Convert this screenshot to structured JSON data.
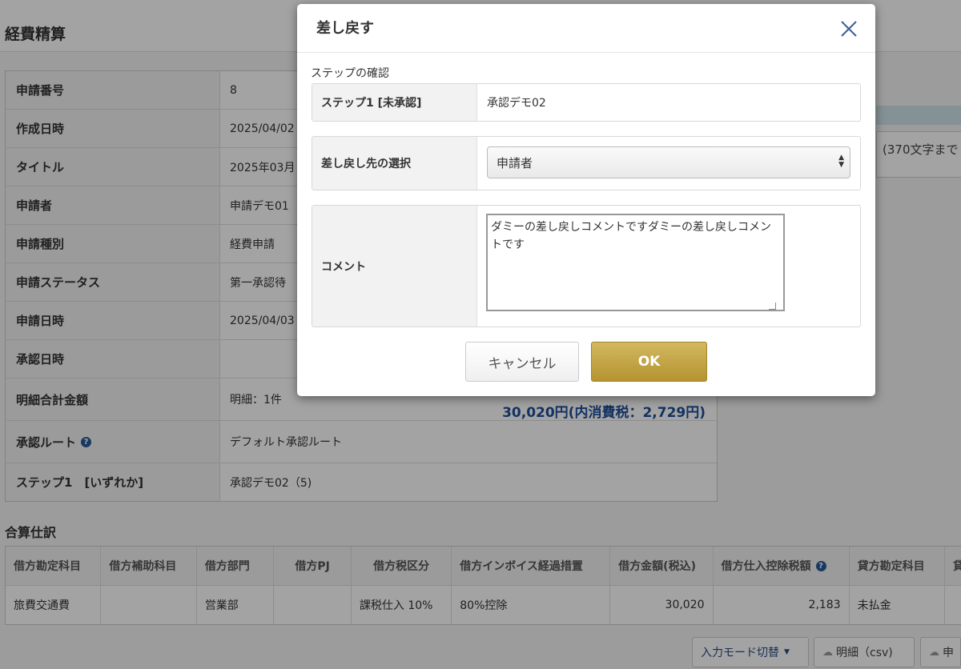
{
  "page": {
    "title": "経費精算",
    "info_rows": [
      {
        "label": "申請番号",
        "value": "8"
      },
      {
        "label": "作成日時",
        "value": "2025/04/02"
      },
      {
        "label": "タイトル",
        "value": "2025年03月"
      },
      {
        "label": "申請者",
        "value": "申請デモ01"
      },
      {
        "label": "申請種別",
        "value": "経費申請"
      },
      {
        "label": "申請ステータス",
        "value": "第一承認待"
      },
      {
        "label": "申請日時",
        "value": "2025/04/03"
      },
      {
        "label": "承認日時",
        "value": ""
      },
      {
        "label": "明細合計金額",
        "value": "明細：1件",
        "amount": "30,020円(内消費税：2,729円)"
      },
      {
        "label": "承認ルート",
        "value": "デフォルト承認ルート"
      },
      {
        "label": "ステップ1　[いずれか]",
        "value": "承認デモ02（5)"
      }
    ],
    "right_panel_text": "(370文字まで",
    "journal_title": "合算仕訳",
    "journal_headers": [
      "借方勘定科目",
      "借方補助科目",
      "借方部門",
      "借方PJ",
      "借方税区分",
      "借方インボイス経過措置",
      "借方金額(税込)",
      "借方仕入控除税額",
      "貸方勘定科目",
      "貸"
    ],
    "journal_row": [
      "旅費交通費",
      "",
      "営業部",
      "",
      "課税仕入 10%",
      "80%控除",
      "30,020",
      "2,183",
      "未払金",
      ""
    ],
    "bottom_buttons": {
      "mode": "入力モード切替",
      "csv": "明細（csv)",
      "third": "申"
    }
  },
  "modal": {
    "title": "差し戻す",
    "step_caption": "ステップの確認",
    "step_label": "ステップ1 [未承認]",
    "step_value": "承認デモ02",
    "target_label": "差し戻し先の選択",
    "target_selected": "申請者",
    "comment_label": "コメント",
    "comment_value": "ダミーの差し戻しコメントですダミーの差し戻しコメントです",
    "cancel_label": "キャンセル",
    "ok_label": "OK"
  }
}
